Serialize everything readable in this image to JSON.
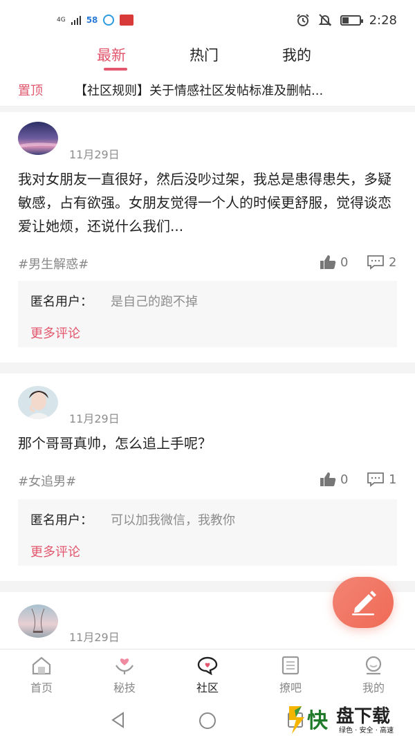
{
  "status_bar": {
    "network": "4G",
    "app_58": "58",
    "time": "2:28"
  },
  "tabs": [
    {
      "label": "最新",
      "active": true
    },
    {
      "label": "热门",
      "active": false
    },
    {
      "label": "我的",
      "active": false
    }
  ],
  "pinned": {
    "badge": "置顶",
    "title": "【社区规则】关于情感社区发帖标准及删帖..."
  },
  "posts": [
    {
      "date": "11月29日",
      "text": "我对女朋友一直很好，然后没吵过架，我总是患得患失，多疑敏感，占有欲强。女朋友觉得一个人的时候更舒服，觉得谈恋爱让她烦，还说什么我们...",
      "tag": "#男生解惑#",
      "likes": "0",
      "comments": "2",
      "comment_user": "匿名用户：",
      "comment_text": "是自己的跑不掉",
      "more_label": "更多评论"
    },
    {
      "date": "11月29日",
      "text": "那个哥哥真帅，怎么追上手呢？",
      "tag": "#女追男#",
      "likes": "0",
      "comments": "1",
      "comment_user": "匿名用户：",
      "comment_text": "可以加我微信，我教你",
      "more_label": "更多评论"
    },
    {
      "date": "11月29日"
    }
  ],
  "bottom_nav": [
    {
      "label": "首页",
      "icon": "home-icon",
      "active": false
    },
    {
      "label": "秘技",
      "icon": "heart-hands-icon",
      "active": false
    },
    {
      "label": "社区",
      "icon": "chat-heart-icon",
      "active": true
    },
    {
      "label": "撩吧",
      "icon": "list-icon",
      "active": false
    },
    {
      "label": "我的",
      "icon": "profile-icon",
      "active": false
    }
  ],
  "watermark": {
    "char": "快",
    "name": "盘下载",
    "slogan": "绿色 · 安全 · 高速"
  },
  "colors": {
    "accent": "#e2576d",
    "fab": "#ef6a55",
    "background": "#f4f4f4"
  }
}
